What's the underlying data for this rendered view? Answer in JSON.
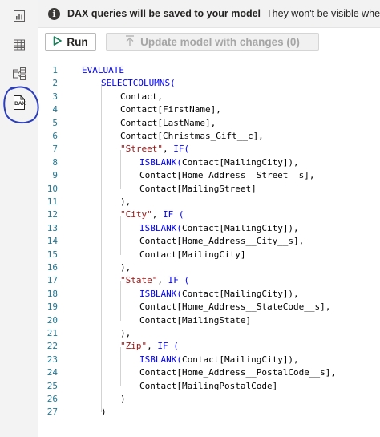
{
  "colors": {
    "keyword": "#0000ff",
    "text": "#000000",
    "string": "#a31515",
    "line_number": "#237893",
    "run_play": "#1a7f5a",
    "annotation_circle": "#2b3fbe"
  },
  "sidebar": {
    "items": [
      {
        "icon": "report-view-icon"
      },
      {
        "icon": "table-view-icon"
      },
      {
        "icon": "model-view-icon"
      },
      {
        "icon": "dax-query-view-icon",
        "label": "DAX",
        "selected": true
      }
    ]
  },
  "info_bar": {
    "title": "DAX queries will be saved to your model",
    "message": "They won't be visible when published i"
  },
  "toolbar": {
    "run_label": "Run",
    "update_label": "Update model with changes (0)"
  },
  "editor": {
    "lines": [
      {
        "num": "1",
        "tokens": [
          {
            "t": "EVALUATE",
            "k": "kw"
          }
        ]
      },
      {
        "num": "2",
        "tokens": [
          {
            "t": "SELECTCOLUMNS(",
            "k": "kw"
          }
        ]
      },
      {
        "num": "3",
        "tokens": [
          {
            "t": "Contact,",
            "k": "tx"
          }
        ]
      },
      {
        "num": "4",
        "tokens": [
          {
            "t": "Contact[FirstName],",
            "k": "tx"
          }
        ]
      },
      {
        "num": "5",
        "tokens": [
          {
            "t": "Contact[LastName],",
            "k": "tx"
          }
        ]
      },
      {
        "num": "6",
        "tokens": [
          {
            "t": "Contact[Christmas_Gift__c],",
            "k": "tx"
          }
        ]
      },
      {
        "num": "7",
        "tokens": [
          {
            "t": "\"Street\"",
            "k": "str"
          },
          {
            "t": ", ",
            "k": "tx"
          },
          {
            "t": "IF(",
            "k": "kw"
          }
        ]
      },
      {
        "num": "8",
        "tokens": [
          {
            "t": "ISBLANK(",
            "k": "kw"
          },
          {
            "t": "Contact[MailingCity]),",
            "k": "tx"
          }
        ]
      },
      {
        "num": "9",
        "tokens": [
          {
            "t": "Contact[Home_Address__Street__s],",
            "k": "tx"
          }
        ]
      },
      {
        "num": "10",
        "tokens": [
          {
            "t": "Contact[MailingStreet]",
            "k": "tx"
          }
        ]
      },
      {
        "num": "11",
        "tokens": [
          {
            "t": "),",
            "k": "tx"
          }
        ]
      },
      {
        "num": "12",
        "tokens": [
          {
            "t": "\"City\"",
            "k": "str"
          },
          {
            "t": ", ",
            "k": "tx"
          },
          {
            "t": "IF (",
            "k": "kw"
          }
        ]
      },
      {
        "num": "13",
        "tokens": [
          {
            "t": "ISBLANK(",
            "k": "kw"
          },
          {
            "t": "Contact[MailingCity]),",
            "k": "tx"
          }
        ]
      },
      {
        "num": "14",
        "tokens": [
          {
            "t": "Contact[Home_Address__City__s],",
            "k": "tx"
          }
        ]
      },
      {
        "num": "15",
        "tokens": [
          {
            "t": "Contact[MailingCity]",
            "k": "tx"
          }
        ]
      },
      {
        "num": "16",
        "tokens": [
          {
            "t": "),",
            "k": "tx"
          }
        ]
      },
      {
        "num": "17",
        "tokens": [
          {
            "t": "\"State\"",
            "k": "str"
          },
          {
            "t": ", ",
            "k": "tx"
          },
          {
            "t": "IF (",
            "k": "kw"
          }
        ]
      },
      {
        "num": "18",
        "tokens": [
          {
            "t": "ISBLANK(",
            "k": "kw"
          },
          {
            "t": "Contact[MailingCity]),",
            "k": "tx"
          }
        ]
      },
      {
        "num": "19",
        "tokens": [
          {
            "t": "Contact[Home_Address__StateCode__s],",
            "k": "tx"
          }
        ]
      },
      {
        "num": "20",
        "tokens": [
          {
            "t": "Contact[MailingState]",
            "k": "tx"
          }
        ]
      },
      {
        "num": "21",
        "tokens": [
          {
            "t": "),",
            "k": "tx"
          }
        ]
      },
      {
        "num": "22",
        "tokens": [
          {
            "t": "\"Zip\"",
            "k": "str"
          },
          {
            "t": ", ",
            "k": "tx"
          },
          {
            "t": "IF (",
            "k": "kw"
          }
        ]
      },
      {
        "num": "23",
        "tokens": [
          {
            "t": "ISBLANK(",
            "k": "kw"
          },
          {
            "t": "Contact[MailingCity]),",
            "k": "tx"
          }
        ]
      },
      {
        "num": "24",
        "tokens": [
          {
            "t": "Contact[Home_Address__PostalCode__s],",
            "k": "tx"
          }
        ]
      },
      {
        "num": "25",
        "tokens": [
          {
            "t": "Contact[MailingPostalCode]",
            "k": "tx"
          }
        ]
      },
      {
        "num": "26",
        "tokens": [
          {
            "t": ")",
            "k": "tx"
          }
        ]
      },
      {
        "num": "27",
        "tokens": [
          {
            "t": ")",
            "k": "tx"
          }
        ]
      }
    ]
  }
}
